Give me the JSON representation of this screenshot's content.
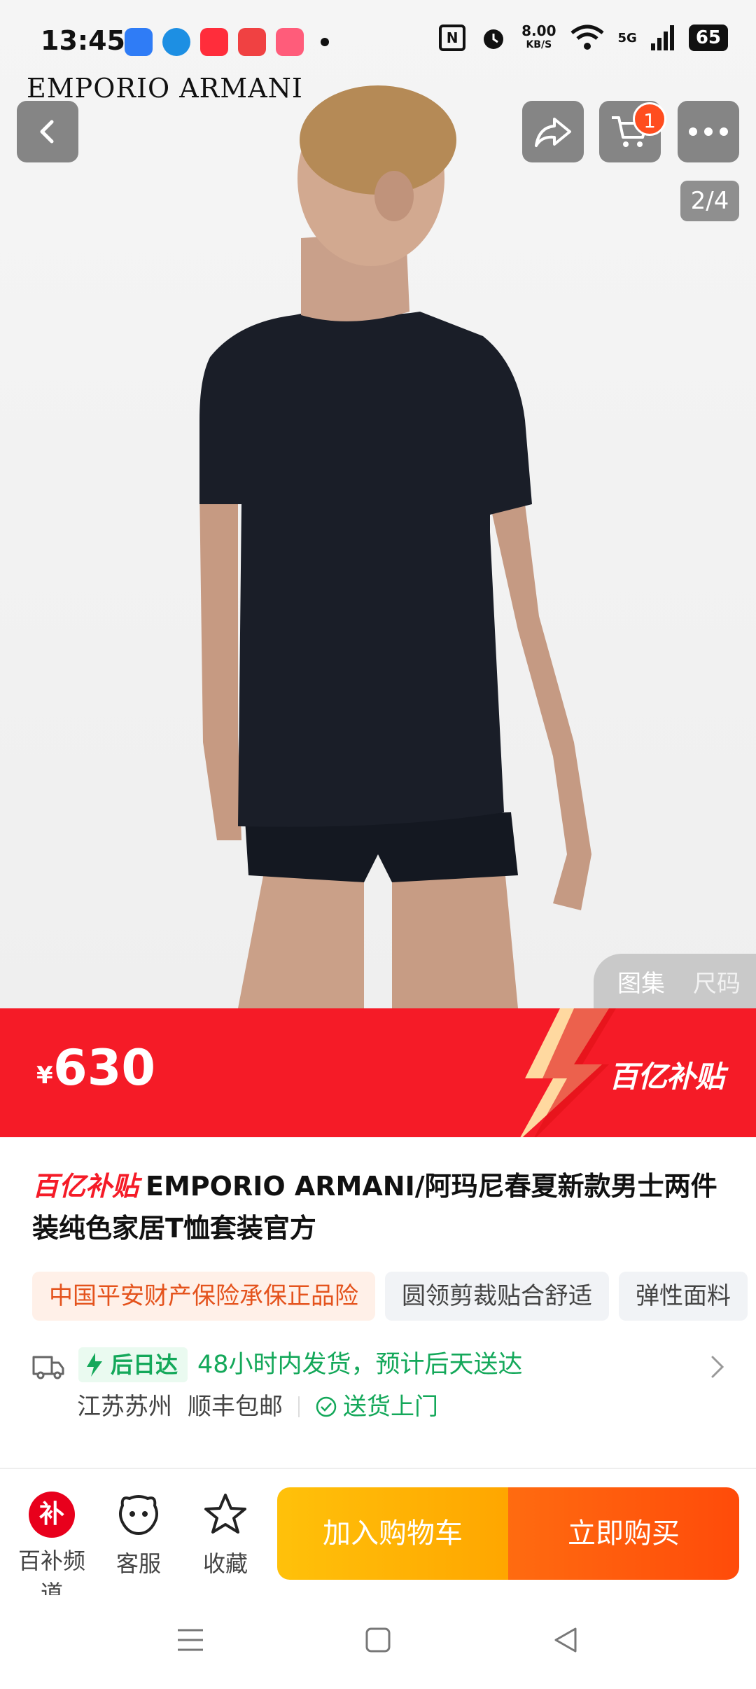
{
  "status_bar": {
    "time": "13:45",
    "app_icons": [
      {
        "name": "qq-browser-icon",
        "color": "#2f7cf6"
      },
      {
        "name": "edge-icon",
        "color": "#1d8fe3"
      },
      {
        "name": "video-app-icon",
        "color": "#ff2d3b"
      },
      {
        "name": "toutiao-icon",
        "color": "#f04142"
      },
      {
        "name": "pinduoduo-lite-icon",
        "color": "#ff5c7a"
      }
    ],
    "nfc": "N",
    "speed_value": "8.00",
    "speed_unit": "KB/S",
    "network": "5G",
    "battery": "65"
  },
  "header": {
    "brand_logo": "EMPORIO ARMANI",
    "page_indicator": "2/4",
    "cart_count": "1",
    "icons": {
      "back": "back-chevron-icon",
      "share": "share-icon",
      "cart": "shopping-cart-icon",
      "more": "more-dots-icon"
    }
  },
  "gallery": {
    "tabs": [
      {
        "label": "图集"
      },
      {
        "label": "尺码"
      }
    ]
  },
  "price": {
    "currency": "¥",
    "value": "630",
    "badge": "百亿补贴",
    "colors": {
      "banner": "#f51b27"
    }
  },
  "product": {
    "title_tag": "百亿补贴",
    "title": "EMPORIO ARMANI/阿玛尼春夏新款男士两件装纯色家居T恤套装官方",
    "tags": [
      {
        "label": "中国平安财产保险承保正品险"
      },
      {
        "label": "圆领剪裁贴合舒适"
      },
      {
        "label": "弹性面料"
      }
    ]
  },
  "delivery": {
    "badge": "后日达",
    "text": "48小时内发货，预计后天送达",
    "origin": "江苏苏州",
    "shipping": "顺丰包邮",
    "door": "送货上门"
  },
  "bottom_bar": {
    "subsidy_icon": "补",
    "subsidy_label": "百补频道",
    "service_label": "客服",
    "favorite_label": "收藏",
    "add_to_cart": "加入购物车",
    "buy_now": "立即购买"
  }
}
